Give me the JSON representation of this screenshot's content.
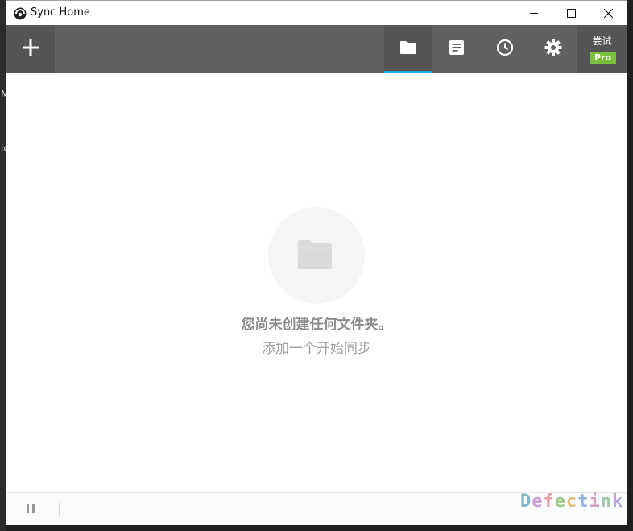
{
  "window": {
    "title": "Sync Home",
    "controls": {
      "minimize_icon": "minimize-icon",
      "maximize_icon": "maximize-icon",
      "close_icon": "close-icon"
    }
  },
  "background_fragments": [
    "M",
    "ic"
  ],
  "toolbar": {
    "add_icon": "plus-icon",
    "tabs": [
      {
        "name": "folders",
        "icon": "folder-icon",
        "active": true
      },
      {
        "name": "history",
        "icon": "document-icon",
        "active": false
      },
      {
        "name": "recent",
        "icon": "clock-icon",
        "active": false
      },
      {
        "name": "preferences",
        "icon": "gear-icon",
        "active": false
      }
    ],
    "accent_color": "#1fa7e1",
    "try_label": "尝试",
    "pro_label": "Pro",
    "pro_color": "#79c13d"
  },
  "main": {
    "empty_icon": "folder-icon",
    "empty_title": "您尚未创建任何文件夹。",
    "empty_subtitle": "添加一个开始同步"
  },
  "statusbar": {
    "pause_icon": "pause-icon",
    "watermark": "Defectink"
  }
}
